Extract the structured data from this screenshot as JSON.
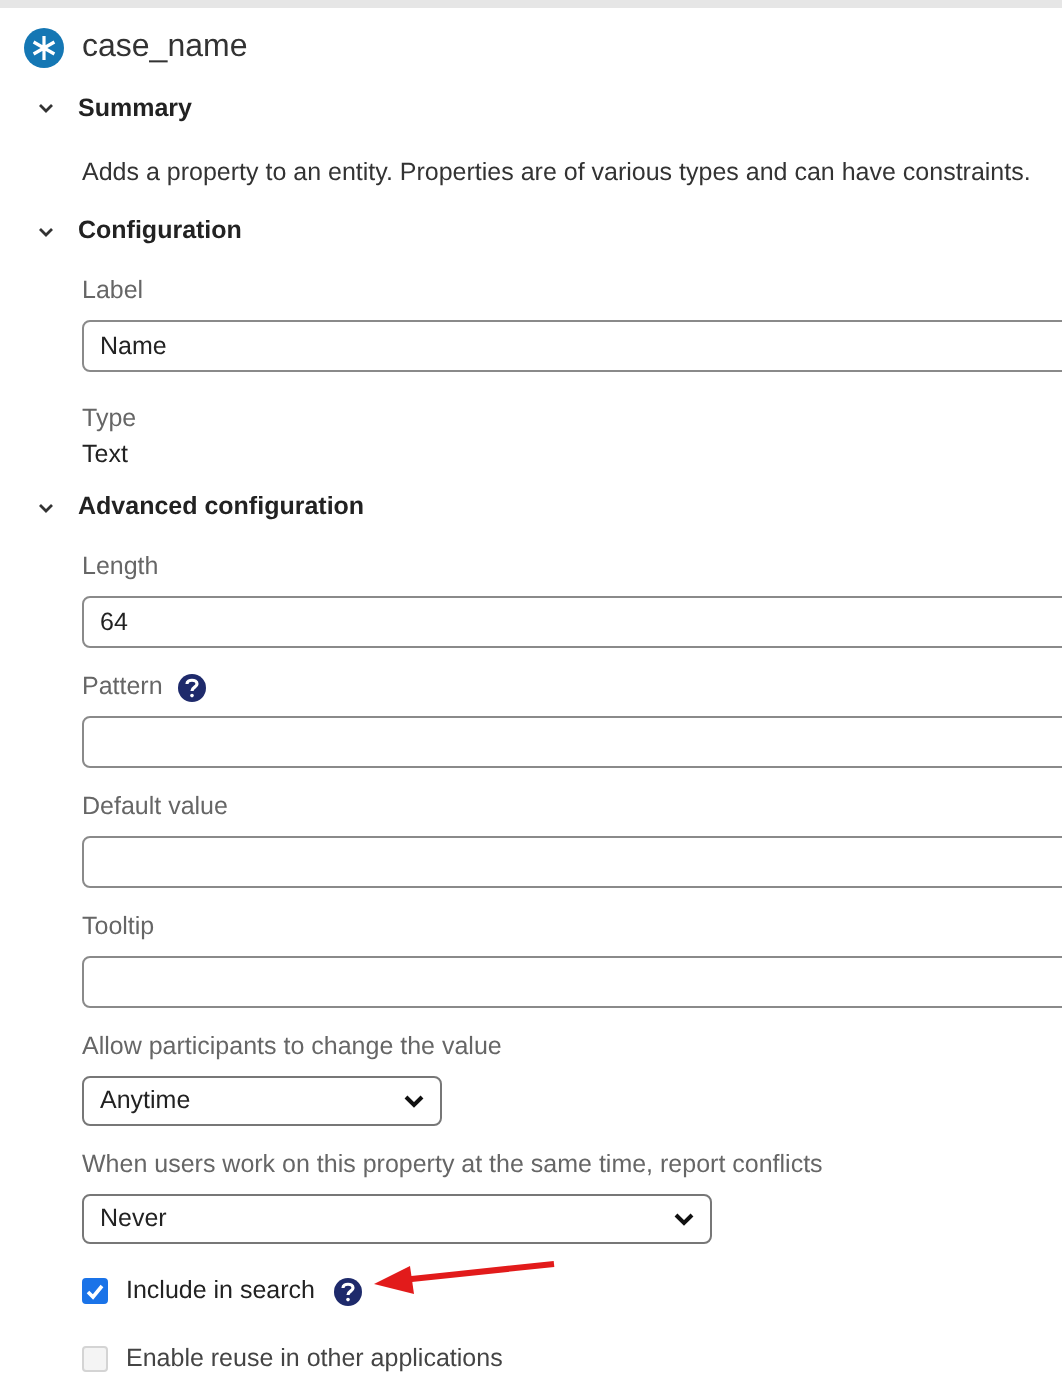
{
  "header": {
    "title": "case_name"
  },
  "sections": [
    {
      "title": "Summary",
      "expanded": true,
      "items": [
        {
          "kind": "text",
          "text": "Adds a property to an entity. Properties are of various types and can have constraints."
        }
      ]
    },
    {
      "title": "Configuration",
      "expanded": true,
      "items": [
        {
          "kind": "input",
          "label": "Label",
          "value": "Name"
        },
        {
          "kind": "static",
          "label": "Type",
          "value": "Text"
        }
      ]
    },
    {
      "title": "Advanced configuration",
      "expanded": true,
      "items": [
        {
          "kind": "input",
          "label": "Length",
          "value": "64"
        },
        {
          "kind": "input",
          "label": "Pattern",
          "help": true
        },
        {
          "kind": "input",
          "label": "Default value"
        },
        {
          "kind": "input",
          "label": "Tooltip"
        },
        {
          "kind": "select",
          "label": "Allow participants to change the value",
          "value": "Anytime",
          "wide": false
        },
        {
          "kind": "select",
          "label": "When users work on this property at the same time, report conflicts",
          "value": "Never",
          "wide": true
        },
        {
          "kind": "checkbox",
          "label": "Include in search",
          "checked": true,
          "disabled": false,
          "help": true,
          "annotated": true
        },
        {
          "kind": "checkbox",
          "label": "Enable reuse in other applications",
          "checked": false,
          "disabled": true,
          "help": false,
          "annotated": false
        }
      ]
    }
  ]
}
